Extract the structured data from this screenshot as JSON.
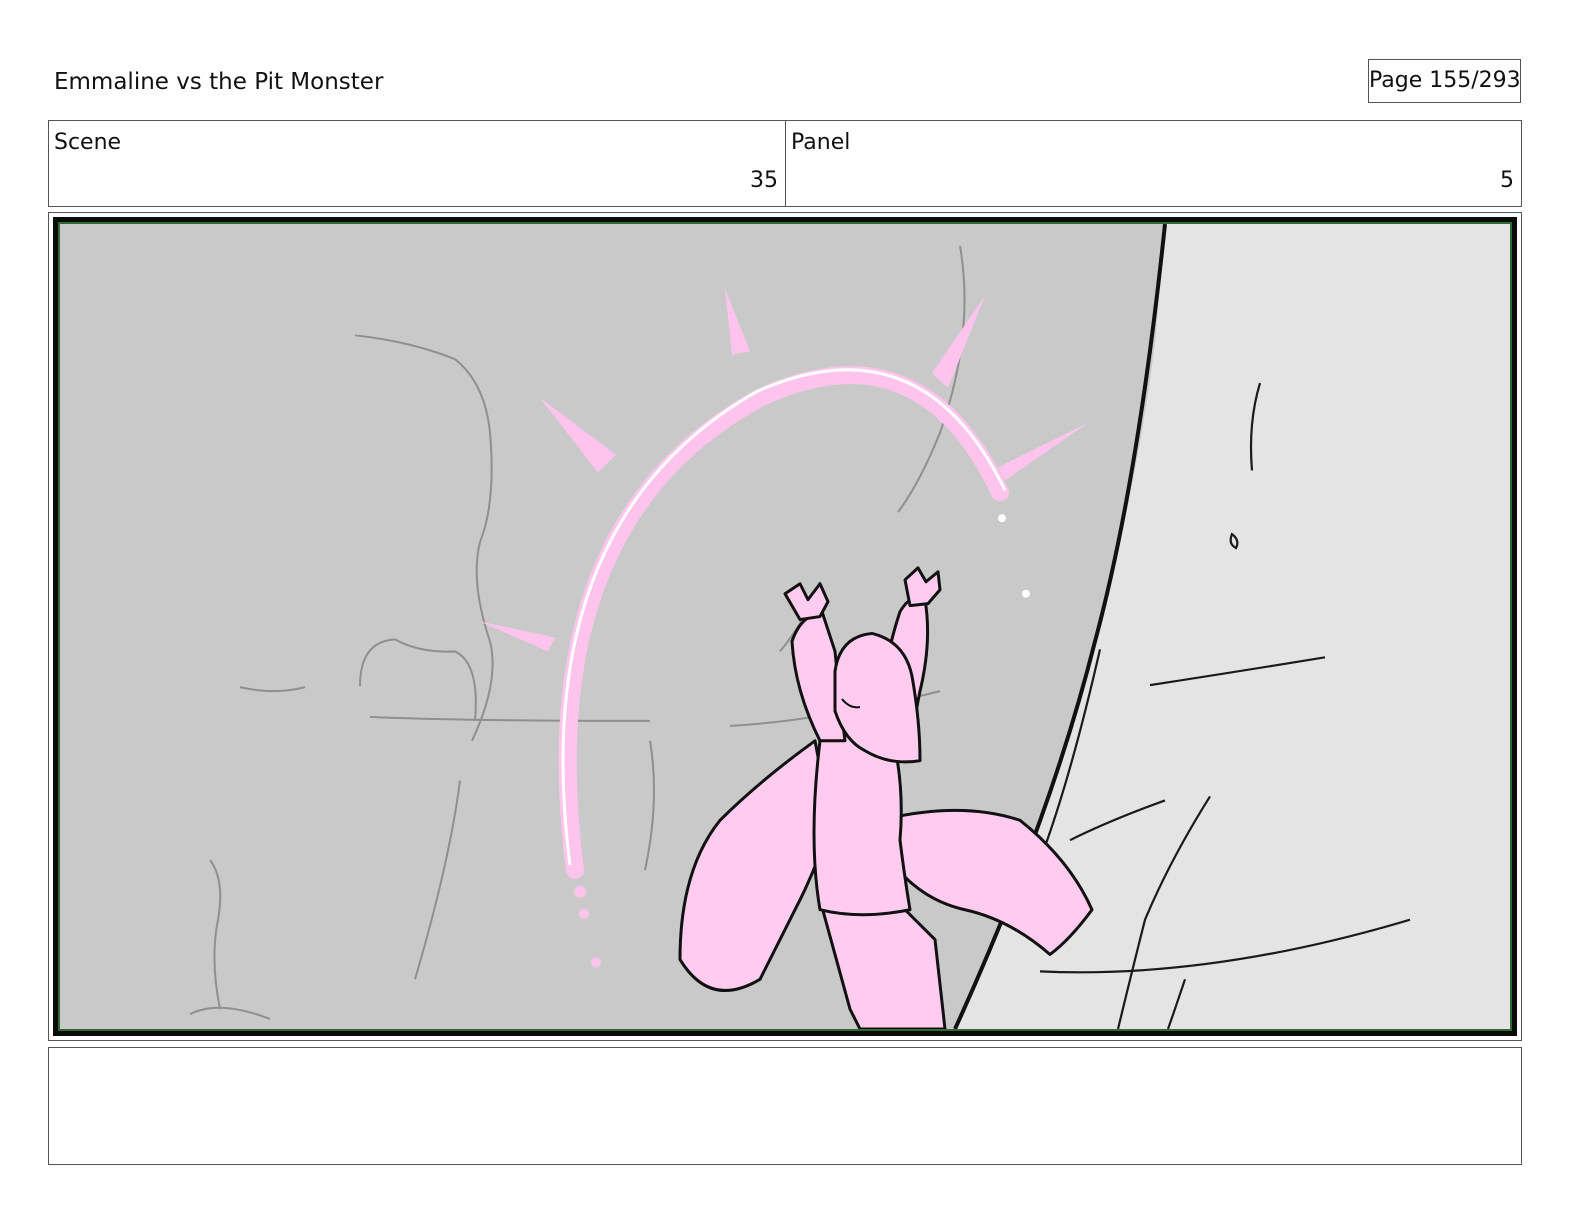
{
  "header": {
    "title": "Emmaline vs the Pit Monster",
    "page_label": "Page 155/293"
  },
  "info": {
    "scene_label": "Scene",
    "scene_value": "35",
    "panel_label": "Panel",
    "panel_value": "5"
  },
  "frame": {
    "background_color": "#c9c9c9",
    "rock_color": "#e4e4e4",
    "figure_color": "#ffccf0",
    "arc_color": "#ffc4ee",
    "border_color": "#0b0b0b",
    "border_accent_color": "#2e6b2e"
  },
  "notes": {
    "text": ""
  }
}
